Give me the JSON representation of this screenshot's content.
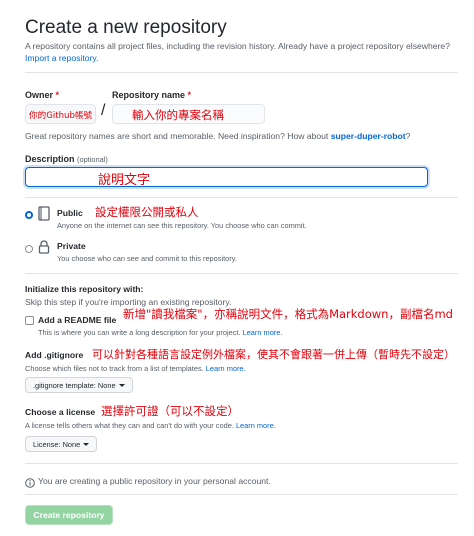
{
  "header": {
    "title": "Create a new repository",
    "subtitle": "A repository contains all project files, including the revision history. Already have a project repository elsewhere?",
    "import_link": "Import a repository."
  },
  "owner": {
    "label": "Owner",
    "required_mark": "*",
    "value": "你的Github帳號"
  },
  "separator": "/",
  "repo_name": {
    "label": "Repository name",
    "required_mark": "*",
    "value": "輸入你的專案名稱"
  },
  "name_hint": {
    "text": "Great repository names are short and memorable. Need inspiration? How about ",
    "suggestion": "super-duper-robot",
    "end": "?"
  },
  "description": {
    "label": "Description",
    "optional": "(optional)",
    "value": "說明文字"
  },
  "visibility": {
    "annotation": "設定權限公開或私人",
    "public": {
      "label": "Public",
      "desc": "Anyone on the internet can see this repository. You choose who can commit.",
      "selected": true
    },
    "private": {
      "label": "Private",
      "desc": "You choose who can see and commit to this repository.",
      "selected": false
    }
  },
  "initialize": {
    "heading": "Initialize this repository with:",
    "hint": "Skip this step if you're importing an existing repository.",
    "readme": {
      "label": "Add a README file",
      "desc": "This is where you can write a long description for your project. ",
      "learn_more": "Learn more.",
      "annotation": "新增\"讀我檔案\"，亦稱說明文件，格式為Markdown，副檔名md",
      "checked": false
    },
    "gitignore": {
      "label": "Add .gitignore",
      "desc": "Choose which files not to track from a list of templates. ",
      "learn_more": "Learn more.",
      "select": ".gitignore template: None",
      "annotation": "可以針對各種語言設定例外檔案，使其不會跟著一併上傳（暫時先不設定）"
    },
    "license": {
      "label": "Choose a license",
      "desc": "A license tells others what they can and can't do with your code. ",
      "learn_more": "Learn more.",
      "select": "License: None",
      "annotation": "選擇許可證（可以不設定）"
    }
  },
  "info": {
    "text": "You are creating a public repository in your personal account."
  },
  "create_button": "Create repository",
  "colors": {
    "accent": "#0366d6",
    "annotation_red": "#e3000b",
    "button_green": "#94d3a2"
  }
}
